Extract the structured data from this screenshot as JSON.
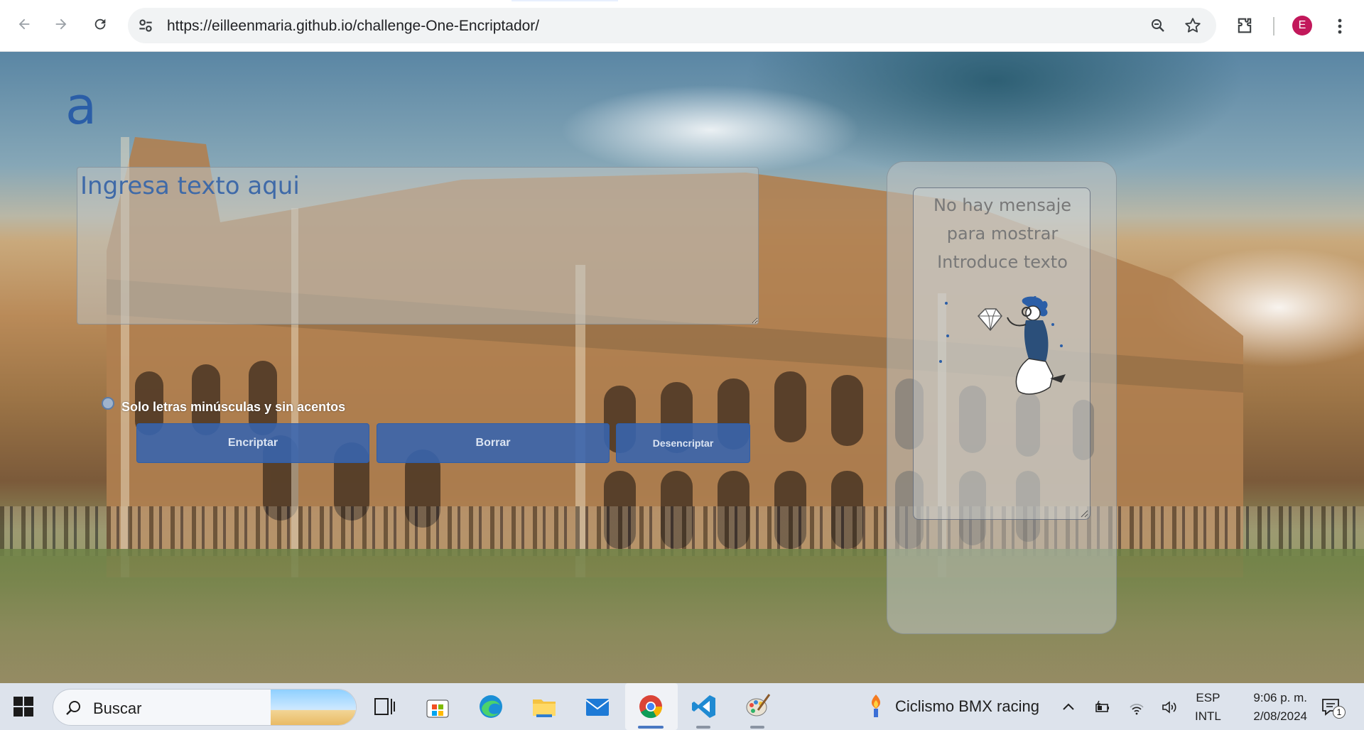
{
  "browser": {
    "url": "https://eilleenmaria.github.io/challenge-One-Encriptador/",
    "avatar_letter": "E",
    "icons": [
      "back-icon",
      "forward-icon",
      "reload-icon",
      "site-info-icon",
      "zoom-icon",
      "star-icon",
      "extensions-icon",
      "menu-icon"
    ]
  },
  "app": {
    "logo_text": "a",
    "input_placeholder": "Ingresa texto aqui",
    "hint": "Solo letras minúsculas y sin acentos",
    "buttons": {
      "encrypt": "Encriptar",
      "clear": "Borrar",
      "decrypt": "Desencriptar"
    },
    "output_message": "No hay mensaje para mostrar Introduce texto",
    "accent_color": "#2b5ea7"
  },
  "taskbar": {
    "search_label": "Buscar",
    "weather_text": "Ciclismo BMX racing",
    "language": [
      "ESP",
      "INTL"
    ],
    "time": "9:06 p. m.",
    "date": "2/08/2024",
    "notification_count": "1",
    "apps": [
      "task-view-icon",
      "microsoft-store-icon",
      "edge-icon",
      "file-explorer-icon",
      "mail-icon",
      "chrome-icon",
      "vscode-icon",
      "paint-icon"
    ]
  }
}
